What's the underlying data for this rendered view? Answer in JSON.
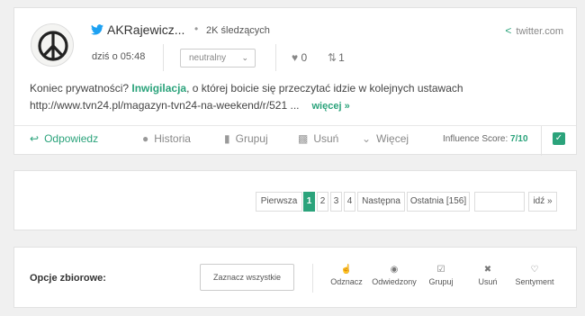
{
  "mention": {
    "author": "AKRajewicz...",
    "followers": "2K śledzących",
    "source": "twitter.com",
    "date": "dziś o 05:48",
    "sentiment": "neutralny",
    "likes": "0",
    "retweets": "1",
    "text_before": "Koniec prywatności? ",
    "text_highlight": "Inwigilacja",
    "text_after": ", o której boicie się przeczytać idzie w kolejnych ustawach",
    "text_link": "http://www.tvn24.pl/magazyn-tvn24-na-weekend/r/521 ...",
    "more_label": "więcej »",
    "actions": {
      "reply": "Odpowiedz",
      "history": "Historia",
      "group": "Grupuj",
      "delete": "Usuń",
      "more": "Więcej"
    },
    "influence_label": "Influence Score: ",
    "influence_value": "7/10"
  },
  "pagination": {
    "first": "Pierwsza",
    "pages": [
      "1",
      "2",
      "3",
      "4"
    ],
    "current": "1",
    "next": "Następna",
    "last": "Ostatnia [156]",
    "go": "idź »"
  },
  "bulk": {
    "label": "Opcje zbiorowe:",
    "select_all": "Zaznacz wszystkie",
    "actions": {
      "mark": "Odznacz",
      "visited": "Odwiedzony",
      "group": "Grupuj",
      "delete": "Usuń",
      "sentiment": "Sentyment"
    }
  },
  "colors": {
    "accent": "#2ba37b",
    "background": "#f0f0f0"
  },
  "icons": [
    "twitter-bird-icon",
    "share-icon",
    "heart-icon",
    "retweet-icon",
    "reply-icon",
    "comment-icon",
    "bookmark-icon",
    "trash-icon",
    "chevron-down-icon",
    "checkmark-icon",
    "hand-pointer-icon",
    "eye-icon",
    "checkbox-icon",
    "close-icon"
  ]
}
